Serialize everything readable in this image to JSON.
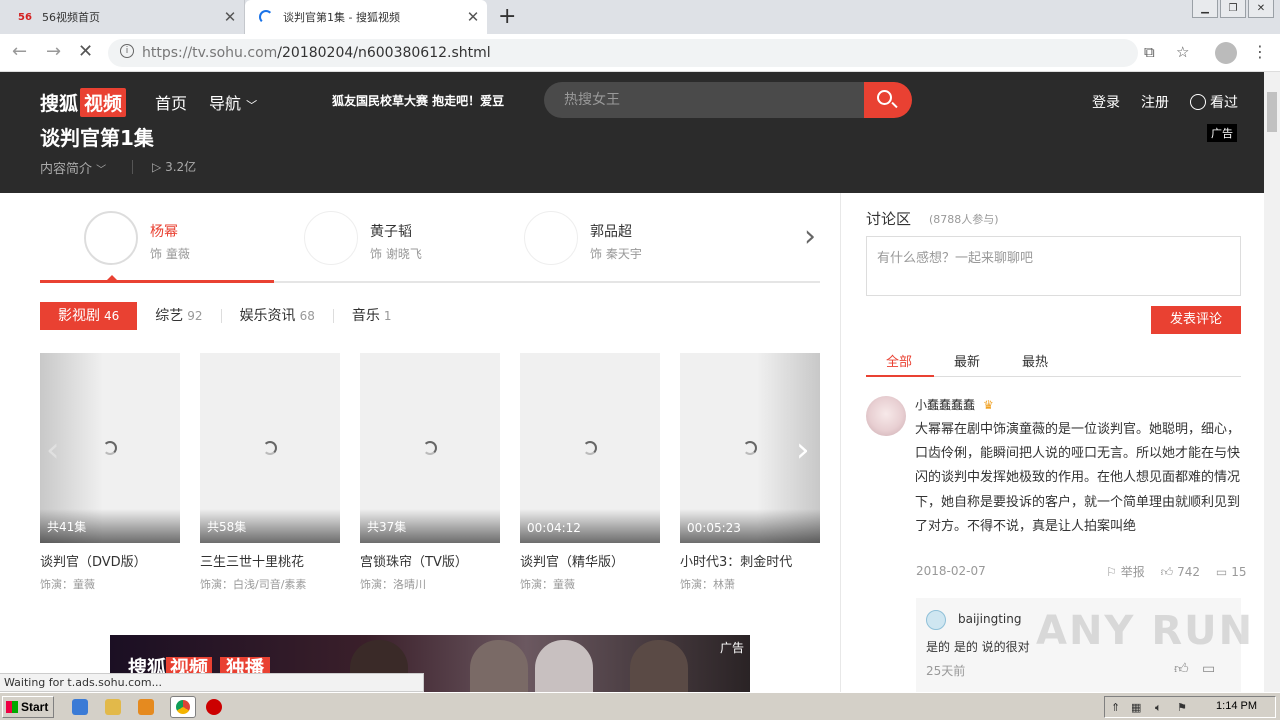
{
  "browser": {
    "tabs": [
      {
        "label": "56视频首页",
        "favicon": "56"
      },
      {
        "label": "谈判官第1集 - 搜狐视频",
        "loading": true
      }
    ],
    "new_tab": "+",
    "url_host": "https://tv.sohu.com",
    "url_path": "/20180204/n600380612.shtml",
    "status_text": "Waiting for t.ads.sohu.com..."
  },
  "header": {
    "logo_a": "搜狐",
    "logo_b": "视频",
    "nav_home": "首页",
    "nav_guide": "导航",
    "promo": "狐友国民校草大赛  抱走吧！爱豆",
    "search_placeholder": "热搜女王",
    "login": "登录",
    "register": "注册",
    "history": "看过"
  },
  "info": {
    "title": "谈判官第1集",
    "intro": "内容简介",
    "plays": "3.2亿",
    "ad": "广告"
  },
  "actors": [
    {
      "name": "杨幂",
      "role": "饰 童薇"
    },
    {
      "name": "黄子韬",
      "role": "饰 谢晓飞"
    },
    {
      "name": "郭品超",
      "role": "饰 秦天宇"
    }
  ],
  "categories": [
    {
      "label": "影视剧",
      "count": "46"
    },
    {
      "label": "综艺",
      "count": "92"
    },
    {
      "label": "娱乐资讯",
      "count": "68"
    },
    {
      "label": "音乐",
      "count": "1"
    }
  ],
  "videos": [
    {
      "badge": "共41集",
      "title": "谈判官（DVD版）",
      "cast": "饰演：童薇"
    },
    {
      "badge": "共58集",
      "title": "三生三世十里桃花",
      "cast": "饰演：白浅/司音/素素"
    },
    {
      "badge": "共37集",
      "title": "宫锁珠帘（TV版）",
      "cast": "饰演：洛晴川"
    },
    {
      "badge": "00:04:12",
      "title": "谈判官（精华版）",
      "cast": "饰演：童薇"
    },
    {
      "badge": "00:05:23",
      "title": "小时代3：刺金时代",
      "cast": "饰演：林萧"
    }
  ],
  "banner": {
    "logo_a": "搜狐",
    "logo_b": "视频",
    "tag": "独播",
    "ad": "广告"
  },
  "discussion": {
    "title": "讨论区",
    "count": "(8788人参与)",
    "placeholder": "有什么感想？一起来聊聊吧",
    "post": "发表评论",
    "tabs": [
      "全部",
      "最新",
      "最热"
    ],
    "comment": {
      "user": "小蠢蠢蠢蠢",
      "text": "大幂幂在剧中饰演童薇的是一位谈判官。她聪明，细心，口齿伶俐，能瞬间把人说的哑口无言。所以她才能在与快闪的谈判中发挥她极致的作用。在他人想见面都难的情况下，她自称是要投诉的客户，就一个简单理由就顺利见到了对方。不得不说，真是让人拍案叫绝",
      "date": "2018-02-07",
      "report": "举报",
      "likes": "742",
      "replies": "15"
    },
    "reply": {
      "user": "baijingting",
      "text": "是的 是的 说的很对",
      "date": "25天前"
    }
  },
  "watermark": "ANY RUN",
  "taskbar": {
    "start": "Start",
    "time": "1:14 PM"
  }
}
